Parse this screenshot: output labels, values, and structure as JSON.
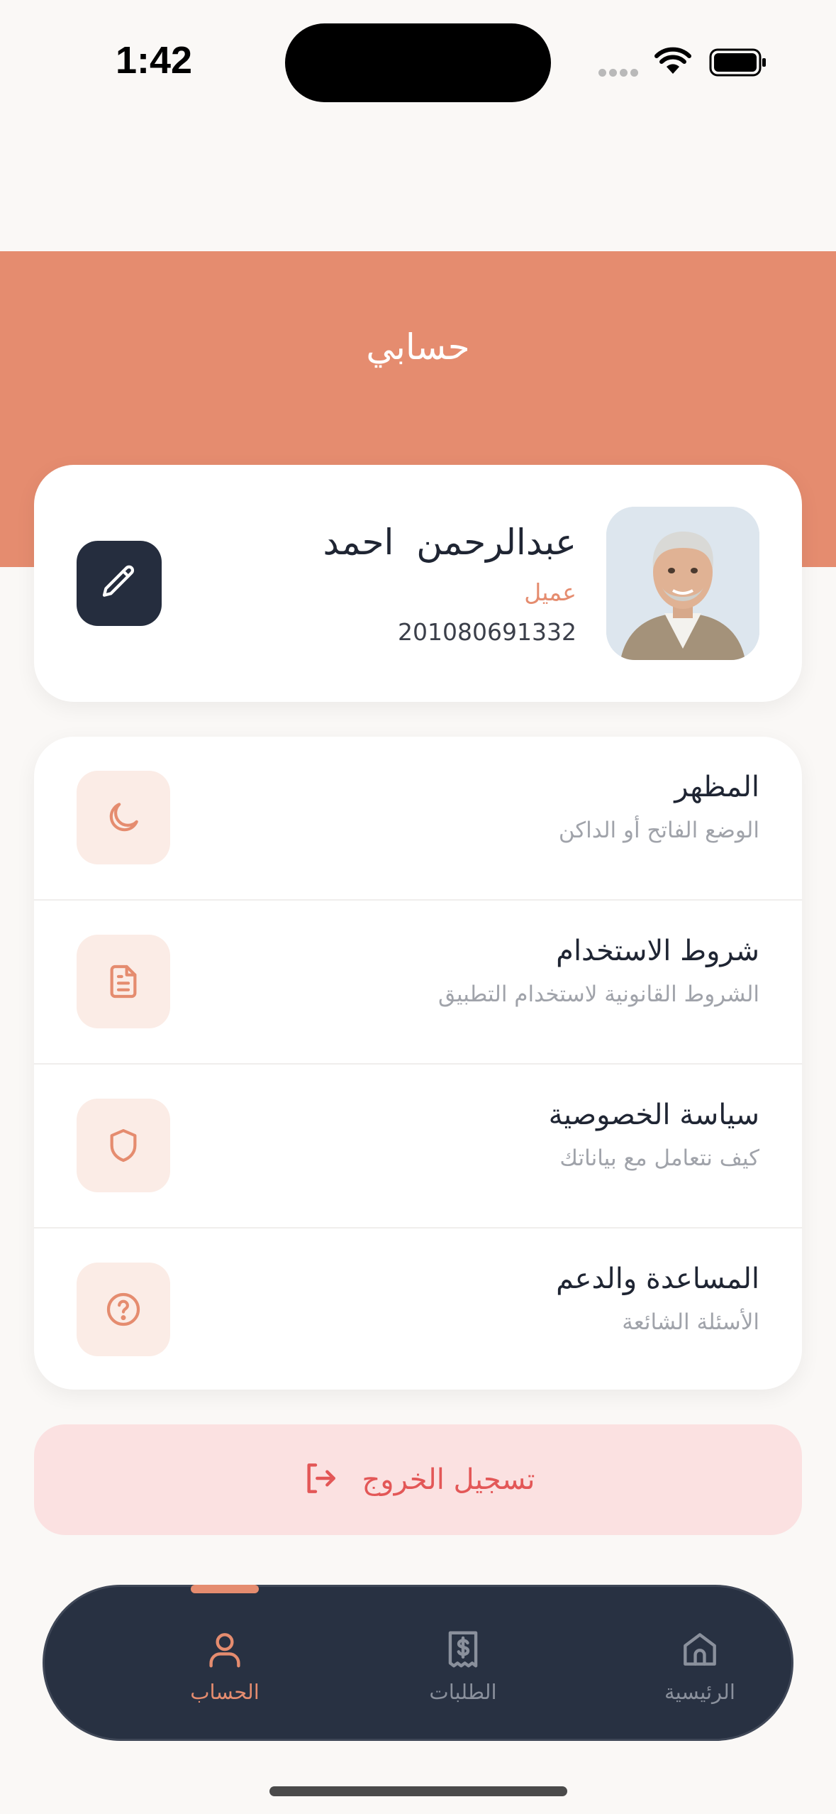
{
  "status_bar": {
    "time": "1:42"
  },
  "header": {
    "title": "حسابي"
  },
  "profile": {
    "name": "عبدالرحمن  احمد",
    "role": "عميل",
    "phone": "201080691332"
  },
  "settings": [
    {
      "title": "المظهر",
      "subtitle": "الوضع الفاتح أو الداكن",
      "icon": "moon-icon"
    },
    {
      "title": "شروط الاستخدام",
      "subtitle": "الشروط القانونية لاستخدام التطبيق",
      "icon": "document-icon"
    },
    {
      "title": "سياسة الخصوصية",
      "subtitle": "كيف نتعامل مع بياناتك",
      "icon": "shield-icon"
    },
    {
      "title": "المساعدة والدعم",
      "subtitle": "الأسئلة الشائعة",
      "icon": "help-circle-icon"
    }
  ],
  "logout": {
    "label": "تسجيل الخروج",
    "icon": "logout-icon"
  },
  "tabs": [
    {
      "label": "الرئيسية",
      "icon": "home-icon",
      "active": false
    },
    {
      "label": "الطلبات",
      "icon": "receipt-icon",
      "active": false
    },
    {
      "label": "الحساب",
      "icon": "user-icon",
      "active": true
    }
  ],
  "colors": {
    "accent": "#e58c6f",
    "dark": "#252d3e",
    "danger": "#e35757",
    "danger_bg": "#fbe1e1",
    "icon_bg": "#fbece6"
  }
}
